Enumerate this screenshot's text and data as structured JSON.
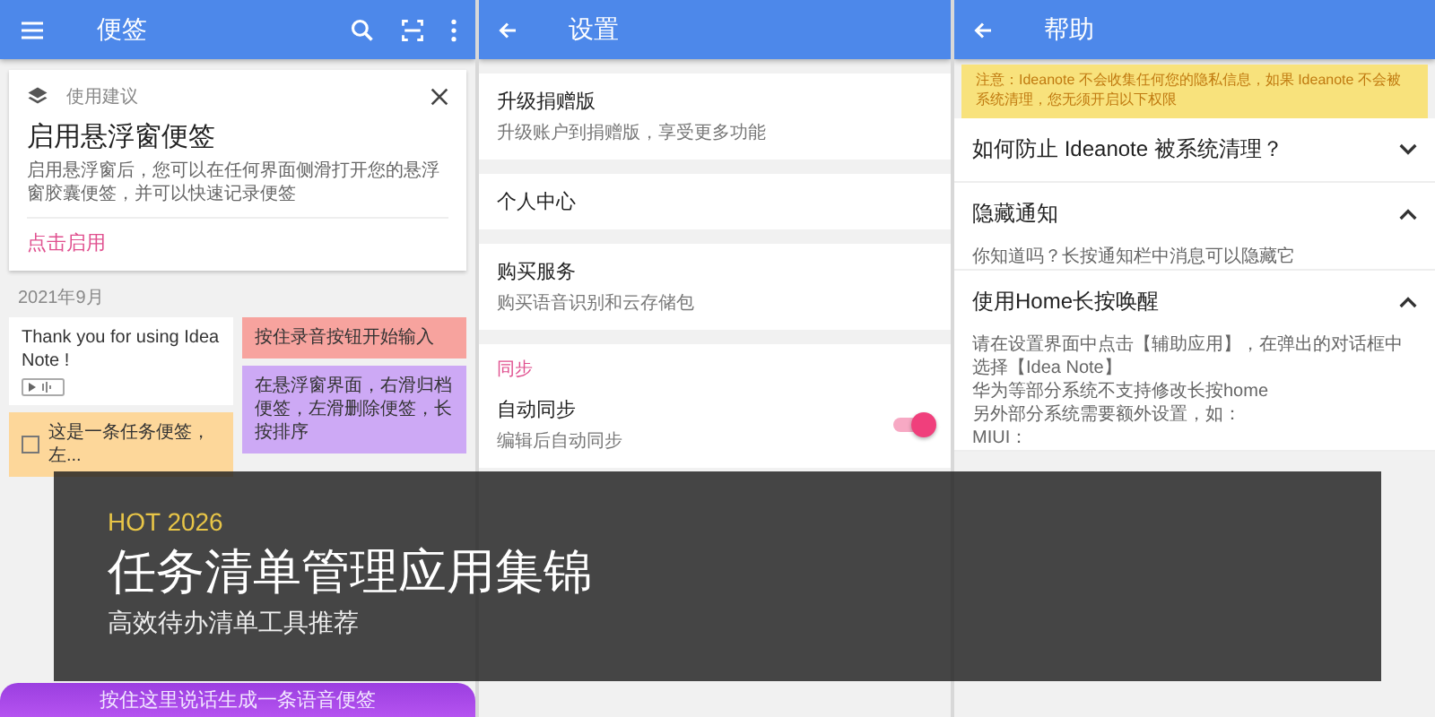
{
  "notes_screen": {
    "title": "便签",
    "suggestion": {
      "label": "使用建议",
      "title": "启用悬浮窗便签",
      "body": "启用悬浮窗后，您可以在任何界面侧滑打开您的悬浮窗胶囊便签，并可以快速记录便签",
      "action": "点击启用"
    },
    "month": "2021年9月",
    "columns": [
      [
        {
          "kind": "text",
          "text": "Thank you for using Idea Note !",
          "audio": true,
          "color": "#ffffff"
        },
        {
          "kind": "task",
          "text": "这是一条任务便签，左...",
          "checked": false,
          "color": "#fdd79a"
        }
      ],
      [
        {
          "kind": "text",
          "text": "按住录音按钮开始输入",
          "audio": false,
          "color": "#f7a39e"
        },
        {
          "kind": "text",
          "text": "在悬浮窗界面，右滑归档便签，左滑删除便签，长按排序",
          "audio": false,
          "color": "#cda9f5"
        }
      ]
    ],
    "voice_hint": "按住这里说话生成一条语音便签"
  },
  "settings_screen": {
    "title": "设置",
    "groups": [
      [
        {
          "kind": "item",
          "title": "升级捐赠版",
          "subtitle": "升级账户到捐赠版，享受更多功能"
        }
      ],
      [
        {
          "kind": "item",
          "title": "个人中心"
        }
      ],
      [
        {
          "kind": "item",
          "title": "购买服务",
          "subtitle": "购买语音识别和云存储包"
        }
      ],
      [
        {
          "kind": "header",
          "title": "同步"
        },
        {
          "kind": "toggle",
          "title": "自动同步",
          "subtitle": "编辑后自动同步",
          "on": true
        }
      ]
    ]
  },
  "help_screen": {
    "title": "帮助",
    "notice": "注意：Ideanote 不会收集任何您的隐私信息，如果 Ideanote 不会被系统清理，您无须开启以下权限",
    "faqs": [
      {
        "title": "如何防止 Ideanote 被系统清理？",
        "expanded": false
      },
      {
        "title": "隐藏通知",
        "expanded": true,
        "body": [
          "你知道吗？长按通知栏中消息可以隐藏它"
        ]
      },
      {
        "title": "使用Home长按唤醒",
        "expanded": true,
        "body": [
          "请在设置界面中点击【辅助应用】，在弹出的对话框中选择【Idea Note】",
          "华为等部分系统不支持修改长按home",
          "另外部分系统需要额外设置，如：",
          "MIUI："
        ]
      }
    ]
  },
  "banner": {
    "tag": "HOT 2026",
    "title": "任务清单管理应用集锦",
    "subtitle": "高效待办清单工具推荐"
  }
}
